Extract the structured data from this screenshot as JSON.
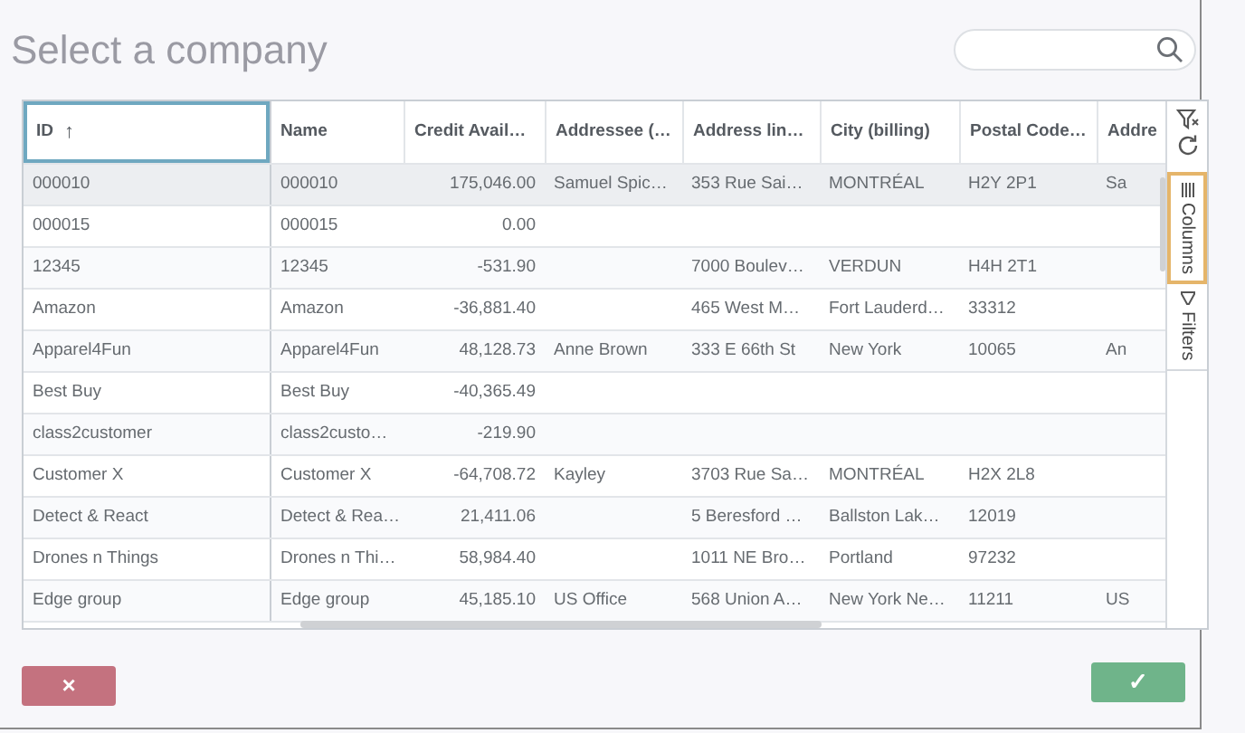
{
  "title": "Select a company",
  "columns": [
    {
      "label": "ID",
      "sort_icon": "↑",
      "focused": true
    },
    {
      "label": "Name",
      "focused": false
    },
    {
      "label": "Credit Avail…",
      "focused": false
    },
    {
      "label": "Addressee (…",
      "focused": false
    },
    {
      "label": "Address lin…",
      "focused": false
    },
    {
      "label": "City (billing)",
      "focused": false
    },
    {
      "label": "Postal Code…",
      "focused": false
    },
    {
      "label": "Addre",
      "focused": false
    }
  ],
  "rows": [
    {
      "selected": true,
      "cells": [
        "000010",
        "000010",
        "175,046.00",
        "Samuel Spic…",
        "353 Rue Sai…",
        "MONTRÉAL",
        "H2Y 2P1",
        "Sa"
      ]
    },
    {
      "selected": false,
      "cells": [
        "000015",
        "000015",
        "0.00",
        "",
        "",
        "",
        "",
        ""
      ]
    },
    {
      "selected": false,
      "cells": [
        "12345",
        "12345",
        "-531.90",
        "",
        "7000 Boulev…",
        "VERDUN",
        "H4H 2T1",
        ""
      ]
    },
    {
      "selected": false,
      "cells": [
        "Amazon",
        "Amazon",
        "-36,881.40",
        "",
        "465 West M…",
        "Fort Lauderd…",
        "33312",
        ""
      ]
    },
    {
      "selected": false,
      "cells": [
        "Apparel4Fun",
        "Apparel4Fun",
        "48,128.73",
        "Anne Brown",
        "333 E 66th St",
        "New York",
        "10065",
        "An"
      ]
    },
    {
      "selected": false,
      "cells": [
        "Best Buy",
        "Best Buy",
        "-40,365.49",
        "",
        "",
        "",
        "",
        ""
      ]
    },
    {
      "selected": false,
      "cells": [
        "class2customer",
        "class2custo…",
        "-219.90",
        "",
        "",
        "",
        "",
        ""
      ]
    },
    {
      "selected": false,
      "cells": [
        "Customer X",
        "Customer X",
        "-64,708.72",
        "Kayley",
        "3703 Rue Sa…",
        "MONTRÉAL",
        "H2X 2L8",
        ""
      ]
    },
    {
      "selected": false,
      "cells": [
        "Detect & React",
        "Detect & Rea…",
        "21,411.06",
        "",
        "5 Beresford …",
        "Ballston Lak…",
        "12019",
        ""
      ]
    },
    {
      "selected": false,
      "cells": [
        "Drones n Things",
        "Drones n Thi…",
        "58,984.40",
        "",
        "1011 NE Bro…",
        "Portland",
        "97232",
        ""
      ]
    },
    {
      "selected": false,
      "cells": [
        "Edge group",
        "Edge group",
        "45,185.10",
        "US Office",
        "568 Union A…",
        "New York Ne…",
        "11211",
        "US"
      ]
    }
  ],
  "side_tabs": [
    {
      "label": "Columns",
      "selected": true
    },
    {
      "label": "Filters",
      "selected": false
    }
  ],
  "buttons": [
    {
      "kind": "cancel",
      "label": "×"
    },
    {
      "kind": "ok",
      "label": "✓"
    }
  ]
}
